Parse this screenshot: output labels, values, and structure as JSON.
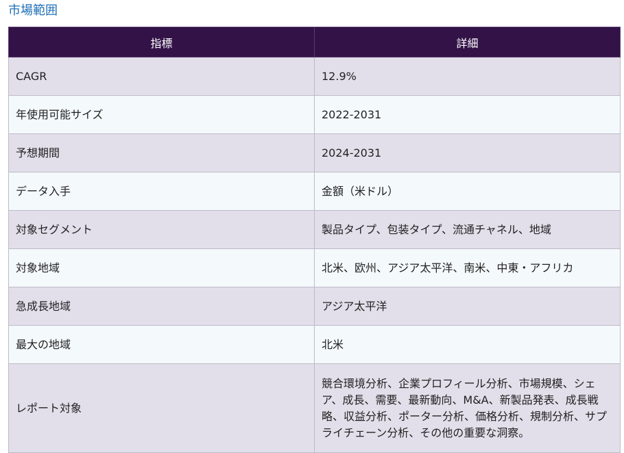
{
  "title": "市場範囲",
  "table": {
    "headers": [
      "指標",
      "詳細"
    ],
    "rows": [
      {
        "metric": "CAGR",
        "detail": "12.9%"
      },
      {
        "metric": "年使用可能サイズ",
        "detail": "2022-2031"
      },
      {
        "metric": "予想期間",
        "detail": "2024-2031"
      },
      {
        "metric": "データ入手",
        "detail": "金額（米ドル）"
      },
      {
        "metric": "対象セグメント",
        "detail": "製品タイプ、包装タイプ、流通チャネル、地域"
      },
      {
        "metric": "対象地域",
        "detail": "北米、欧州、アジア太平洋、南米、中東・アフリカ"
      },
      {
        "metric": "急成長地域",
        "detail": "アジア太平洋"
      },
      {
        "metric": "最大の地域",
        "detail": "北米"
      },
      {
        "metric": "レポート対象",
        "detail": "競合環境分析、企業プロフィール分析、市場規模、シェア、成長、需要、最新動向、M&A、新製品発表、成長戦略、収益分析、ポーター分析、価格分析、規制分析、サプライチェーン分析、その他の重要な洞察。"
      }
    ]
  }
}
